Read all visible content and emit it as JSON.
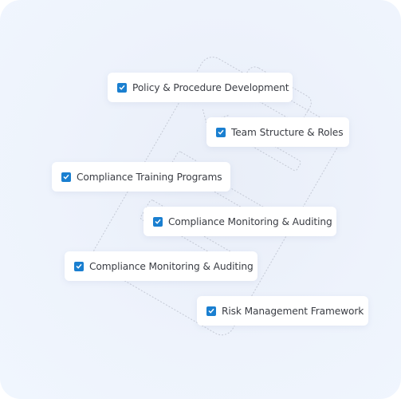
{
  "checklist": {
    "accent_color": "#1a7fd0",
    "items": [
      {
        "label": "Policy & Procedure Development",
        "checked": true
      },
      {
        "label": "Team Structure & Roles",
        "checked": true
      },
      {
        "label": "Compliance Training Programs",
        "checked": true
      },
      {
        "label": "Compliance Monitoring & Auditing",
        "checked": true
      },
      {
        "label": "Compliance Monitoring & Auditing",
        "checked": true
      },
      {
        "label": "Risk Management Framework",
        "checked": true
      }
    ]
  },
  "background_icon": "clipboard-checklist-icon"
}
